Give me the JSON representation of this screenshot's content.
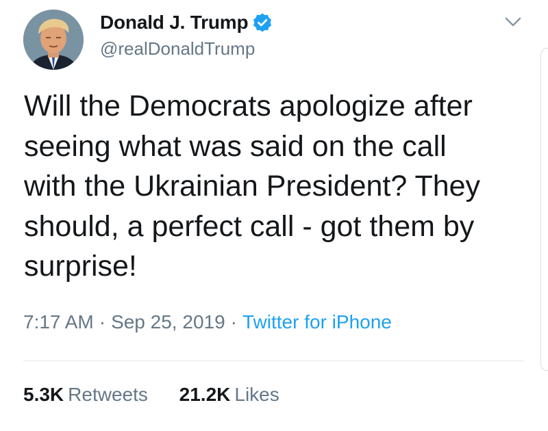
{
  "author": {
    "display_name": "Donald J. Trump",
    "handle": "@realDonaldTrump",
    "verified": true,
    "avatar_icon": "profile-photo"
  },
  "tweet": {
    "text": "Will the Democrats apologize after\nseeing what was said on the call\nwith the Ukrainian President? They\nshould, a perfect call - got them by\nsurprise!",
    "time": "7:17 AM",
    "separator": "·",
    "date": "Sep 25, 2019",
    "source": "Twitter for iPhone"
  },
  "stats": {
    "retweets_count": "5.3K",
    "retweets_label": "Retweets",
    "likes_count": "21.2K",
    "likes_label": "Likes"
  },
  "colors": {
    "verified_badge": "#1da1f2",
    "source_link": "#1da1f2",
    "secondary_text": "#657786",
    "primary_text": "#14171a",
    "divider": "#e1e8ed"
  },
  "icons": {
    "verified": "verified-badge-icon",
    "menu": "chevron-down-icon"
  }
}
